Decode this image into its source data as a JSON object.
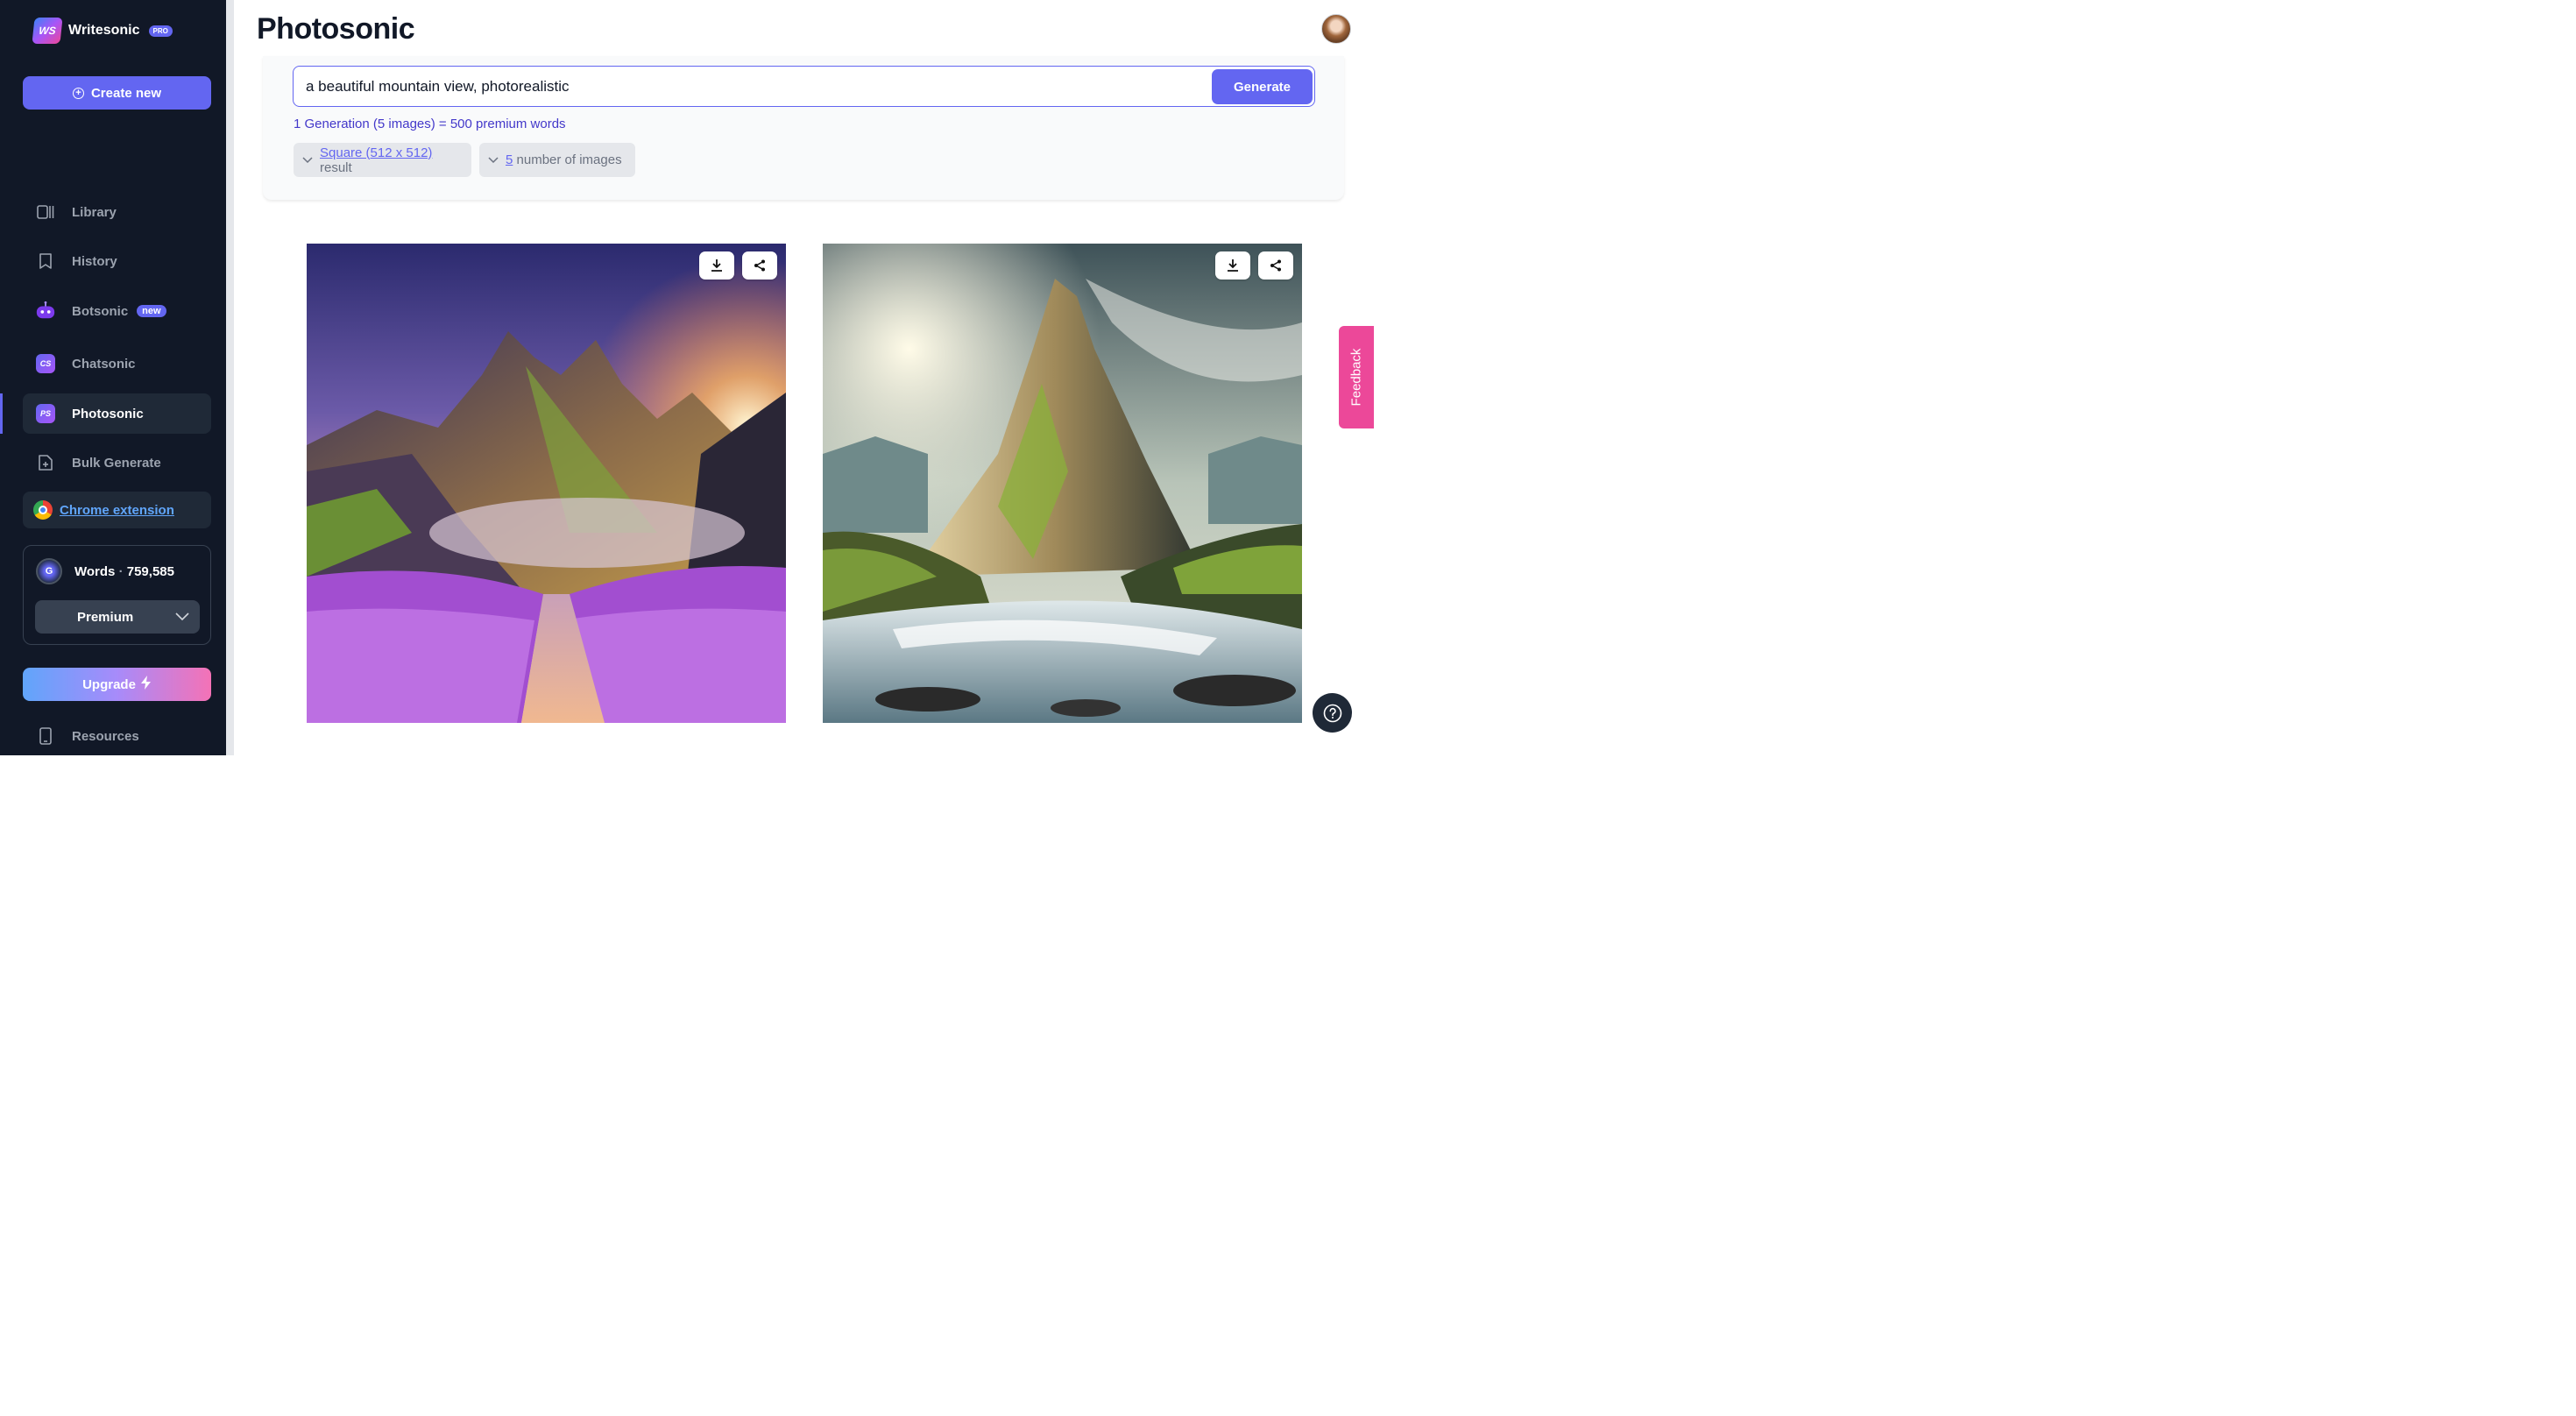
{
  "brand": {
    "name": "Writesonic",
    "logo_text": "WS",
    "badge": "PRO"
  },
  "sidebar": {
    "create_label": "Create new",
    "items": [
      {
        "label": "Library",
        "icon": "library-icon"
      },
      {
        "label": "History",
        "icon": "bookmark-icon"
      },
      {
        "label": "Botsonic",
        "icon": "bot-icon",
        "badge": "new"
      },
      {
        "label": "Chatsonic",
        "icon": "chatsonic-icon",
        "icon_text": "CS"
      },
      {
        "label": "Photosonic",
        "icon": "photosonic-icon",
        "icon_text": "PS",
        "active": true
      },
      {
        "label": "Bulk Generate",
        "icon": "file-plus-icon"
      }
    ],
    "chrome_extension": "Chrome extension",
    "words": {
      "label": "Words",
      "separator": "·",
      "count": "759,585",
      "avatar_text": "G"
    },
    "plan": "Premium",
    "upgrade_label": "Upgrade",
    "resources_label": "Resources"
  },
  "main": {
    "title": "Photosonic",
    "prompt": "a beautiful mountain view, photorealistic",
    "generate_label": "Generate",
    "generation_note": "1 Generation (5 images) = 500 premium words",
    "size_option": {
      "value": "Square (512 x 512)",
      "suffix": "result"
    },
    "count_option": {
      "value": "5",
      "suffix": "number of images"
    }
  },
  "feedback_label": "Feedback",
  "colors": {
    "sidebar_bg": "#111827",
    "accent": "#6366f1",
    "feedback": "#ec4899",
    "active_item": "#1f2937"
  }
}
